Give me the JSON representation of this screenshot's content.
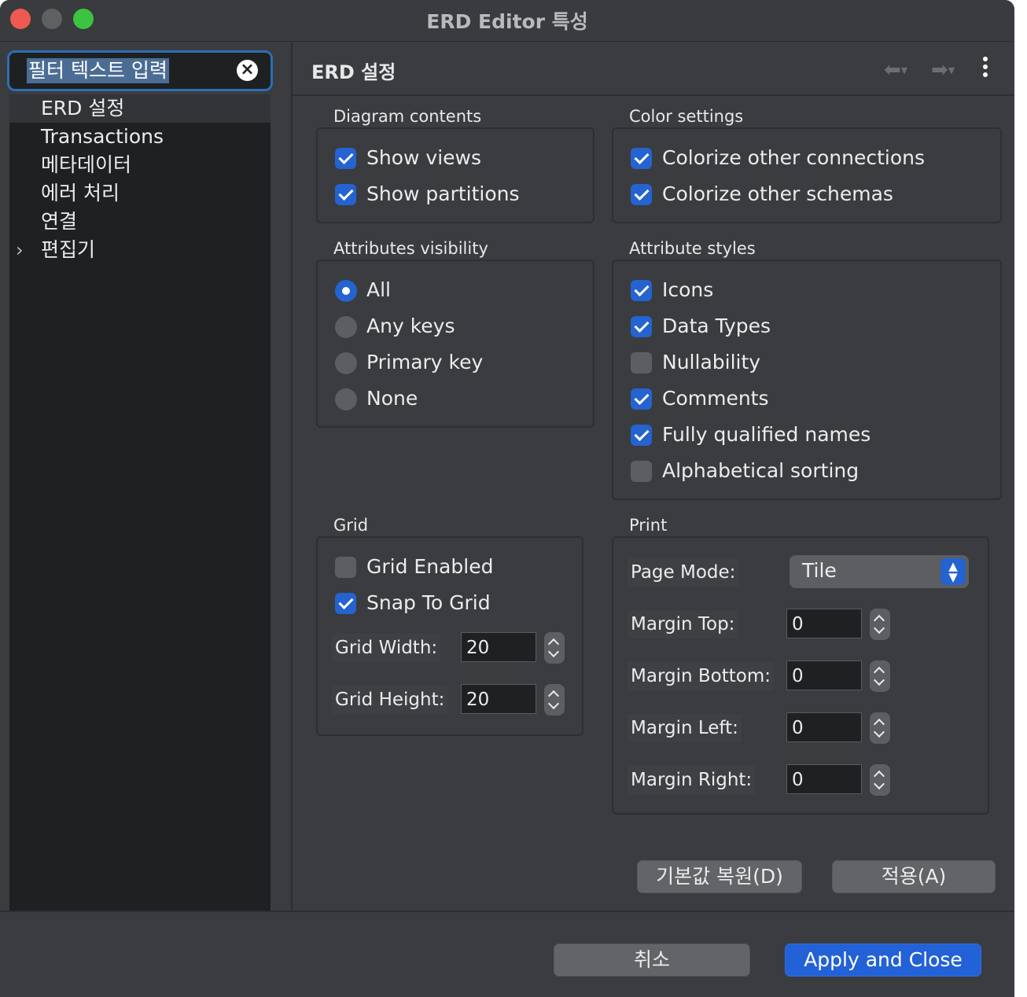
{
  "window": {
    "title": "ERD Editor 특성"
  },
  "sidebar": {
    "filter_text": "필터 텍스트 입력",
    "items": [
      {
        "label": "ERD 설정"
      },
      {
        "label": "Transactions"
      },
      {
        "label": "메타데이터"
      },
      {
        "label": "에러 처리"
      },
      {
        "label": "연결"
      },
      {
        "label": "편집기"
      }
    ]
  },
  "page": {
    "title": "ERD 설정"
  },
  "diagram_contents": {
    "title": "Diagram contents",
    "items": [
      {
        "label": "Show views",
        "checked": true
      },
      {
        "label": "Show partitions",
        "checked": true
      }
    ]
  },
  "color_settings": {
    "title": "Color settings",
    "items": [
      {
        "label": "Colorize other connections",
        "checked": true
      },
      {
        "label": "Colorize other schemas",
        "checked": true
      }
    ]
  },
  "attributes_visibility": {
    "title": "Attributes visibility",
    "selected": "All",
    "options": [
      {
        "label": "All"
      },
      {
        "label": "Any keys"
      },
      {
        "label": "Primary key"
      },
      {
        "label": "None"
      }
    ]
  },
  "attribute_styles": {
    "title": "Attribute styles",
    "items": [
      {
        "label": "Icons",
        "checked": true
      },
      {
        "label": "Data Types",
        "checked": true
      },
      {
        "label": "Nullability",
        "checked": false
      },
      {
        "label": "Comments",
        "checked": true
      },
      {
        "label": "Fully qualified names",
        "checked": true
      },
      {
        "label": "Alphabetical sorting",
        "checked": false
      }
    ]
  },
  "grid": {
    "title": "Grid",
    "enabled": {
      "label": "Grid Enabled",
      "checked": false
    },
    "snap": {
      "label": "Snap To Grid",
      "checked": true
    },
    "width": {
      "label": "Grid Width:",
      "value": "20"
    },
    "height": {
      "label": "Grid Height:",
      "value": "20"
    }
  },
  "print": {
    "title": "Print",
    "page_mode": {
      "label": "Page Mode:",
      "value": "Tile"
    },
    "margin_top": {
      "label": "Margin Top:",
      "value": "0"
    },
    "margin_bottom": {
      "label": "Margin Bottom:",
      "value": "0"
    },
    "margin_left": {
      "label": "Margin Left:",
      "value": "0"
    },
    "margin_right": {
      "label": "Margin Right:",
      "value": "0"
    }
  },
  "buttons": {
    "restore_defaults": "기본값 복원(D)",
    "apply": "적용(A)",
    "cancel": "취소",
    "apply_close": "Apply and Close"
  },
  "colors": {
    "accent": "#2463d0",
    "window_bg": "#3a3c3f",
    "sidebar_bg": "#1f2022",
    "close": "#ee5a52",
    "zoom": "#3cc341"
  }
}
